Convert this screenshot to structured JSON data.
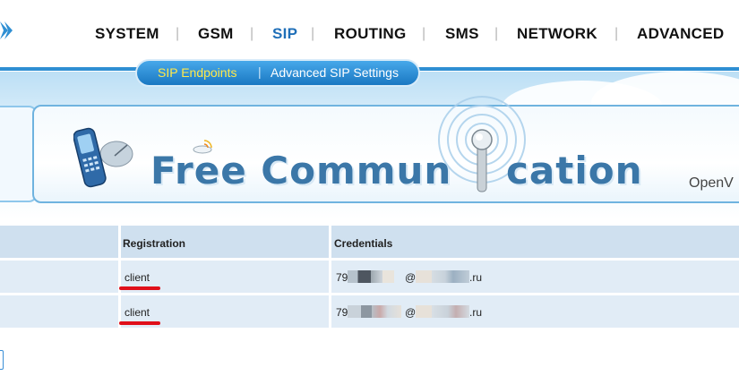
{
  "nav": {
    "items": [
      {
        "label": "SYSTEM",
        "active": false
      },
      {
        "label": "GSM",
        "active": false
      },
      {
        "label": "SIP",
        "active": true
      },
      {
        "label": "ROUTING",
        "active": false
      },
      {
        "label": "SMS",
        "active": false
      },
      {
        "label": "NETWORK",
        "active": false
      },
      {
        "label": "ADVANCED",
        "active": false
      }
    ],
    "separator": "|"
  },
  "subnav": {
    "active_label": "SIP Endpoints",
    "other_label": "Advanced SIP Settings",
    "separator": "|"
  },
  "banner": {
    "text_left": "Free Commun",
    "text_right": "cation",
    "brand_fragment": "OpenV"
  },
  "table": {
    "headers": [
      "",
      "Registration",
      "Credentials"
    ],
    "rows": [
      {
        "registration": "client",
        "cred_prefix": "79",
        "cred_domain_at": "@",
        "cred_domain_tld": ".ru"
      },
      {
        "registration": "client",
        "cred_prefix": "79",
        "cred_domain_at": "@",
        "cred_domain_tld": ".ru"
      }
    ]
  },
  "colors": {
    "accent": "#1f6fb8",
    "subnav_active": "#ffe94a",
    "annotation": "#e0101a",
    "header_row": "#cfe0ef"
  }
}
